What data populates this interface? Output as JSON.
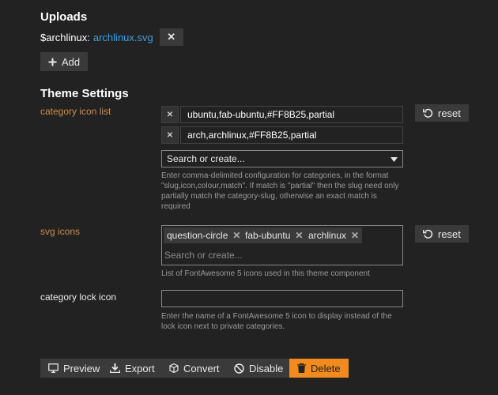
{
  "uploads": {
    "heading": "Uploads",
    "item_name": "$archlinux:",
    "item_link": "archlinux.svg",
    "remove_glyph": "✕",
    "add_label": "Add"
  },
  "theme": {
    "heading": "Theme Settings",
    "category_icon_list": {
      "label": "category icon list",
      "rows": [
        {
          "value": "ubuntu,fab-ubuntu,#FF8B25,partial"
        },
        {
          "value": "arch,archlinux,#FF8B25,partial"
        }
      ],
      "select_placeholder": "Search or create...",
      "help": [
        "Enter comma-delimited configuration for categories, in the format",
        "\"slug,icon,colour,match\". If match is \"partial\" then the slug need only",
        "partially match the category-slug, otherwise an exact match is",
        "required"
      ],
      "reset_label": "reset"
    },
    "svg_icons": {
      "label": "svg icons",
      "chips": [
        "question-circle",
        "fab-ubuntu",
        "archlinux"
      ],
      "placeholder": "Search or create...",
      "help": "List of FontAwesome 5 icons used in this theme component",
      "reset_label": "reset"
    },
    "category_lock_icon": {
      "label": "category lock icon",
      "value": "",
      "help": [
        "Enter the name of a FontAwesome 5 icon to display instead of the",
        "lock icon next to private categories."
      ]
    }
  },
  "actions": {
    "preview": "Preview",
    "export": "Export",
    "convert": "Convert",
    "disable": "Disable",
    "delete": "Delete"
  },
  "colors": {
    "background": "#222222",
    "label_orange": "#d08c4b",
    "link": "#3ea0e0",
    "danger": "#f38a1e"
  }
}
